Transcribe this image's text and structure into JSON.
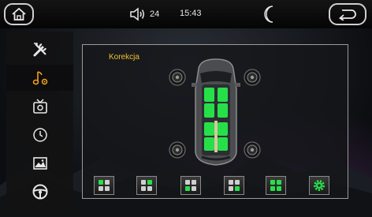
{
  "status": {
    "volume": "24",
    "time": "15:43"
  },
  "panel": {
    "title": "Korekcja"
  },
  "colors": {
    "accent": "#26e04a",
    "title": "#f3c12a"
  },
  "sidebar": {
    "items": [
      {
        "icon": "tools-icon",
        "active": false
      },
      {
        "icon": "music-settings-icon",
        "active": true
      },
      {
        "icon": "tv-settings-icon",
        "active": false
      },
      {
        "icon": "clock-icon",
        "active": false
      },
      {
        "icon": "image-icon",
        "active": false
      },
      {
        "icon": "steering-wheel-icon",
        "active": false
      }
    ]
  },
  "seat_buttons": [
    {
      "icon": "seat-front-left-icon"
    },
    {
      "icon": "seat-front-right-icon"
    },
    {
      "icon": "seat-rear-left-icon"
    },
    {
      "icon": "seat-rear-right-icon"
    },
    {
      "icon": "seat-all-icon"
    },
    {
      "icon": "settings-gear-icon"
    }
  ]
}
